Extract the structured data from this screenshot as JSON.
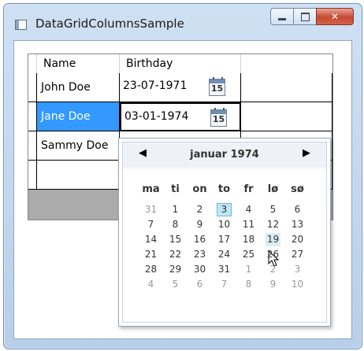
{
  "window": {
    "title": "DataGridColumnsSample"
  },
  "grid": {
    "columns": [
      "Name",
      "Birthday"
    ],
    "rows": [
      {
        "name": "John Doe",
        "birthday": "23-07-1971"
      },
      {
        "name": "Jane Doe",
        "birthday": "03-01-1974"
      },
      {
        "name": "Sammy Doe",
        "birthday": ""
      },
      {
        "name": "",
        "birthday": ""
      }
    ],
    "calendar_icon_text": "15"
  },
  "calendar": {
    "month_label": "januar 1974",
    "prev_glyph": "◀",
    "next_glyph": "▶",
    "weekdays": [
      "ma",
      "ti",
      "on",
      "to",
      "fr",
      "lø",
      "sø"
    ],
    "weeks": [
      [
        "31",
        "1",
        "2",
        "3",
        "4",
        "5",
        "6"
      ],
      [
        "7",
        "8",
        "9",
        "10",
        "11",
        "12",
        "13"
      ],
      [
        "14",
        "15",
        "16",
        "17",
        "18",
        "19",
        "20"
      ],
      [
        "21",
        "22",
        "23",
        "24",
        "25",
        "26",
        "27"
      ],
      [
        "28",
        "29",
        "30",
        "31",
        "1",
        "2",
        "3"
      ],
      [
        "4",
        "5",
        "6",
        "7",
        "8",
        "9",
        "10"
      ]
    ],
    "selected_day": "3",
    "hovered_day": "19"
  }
}
